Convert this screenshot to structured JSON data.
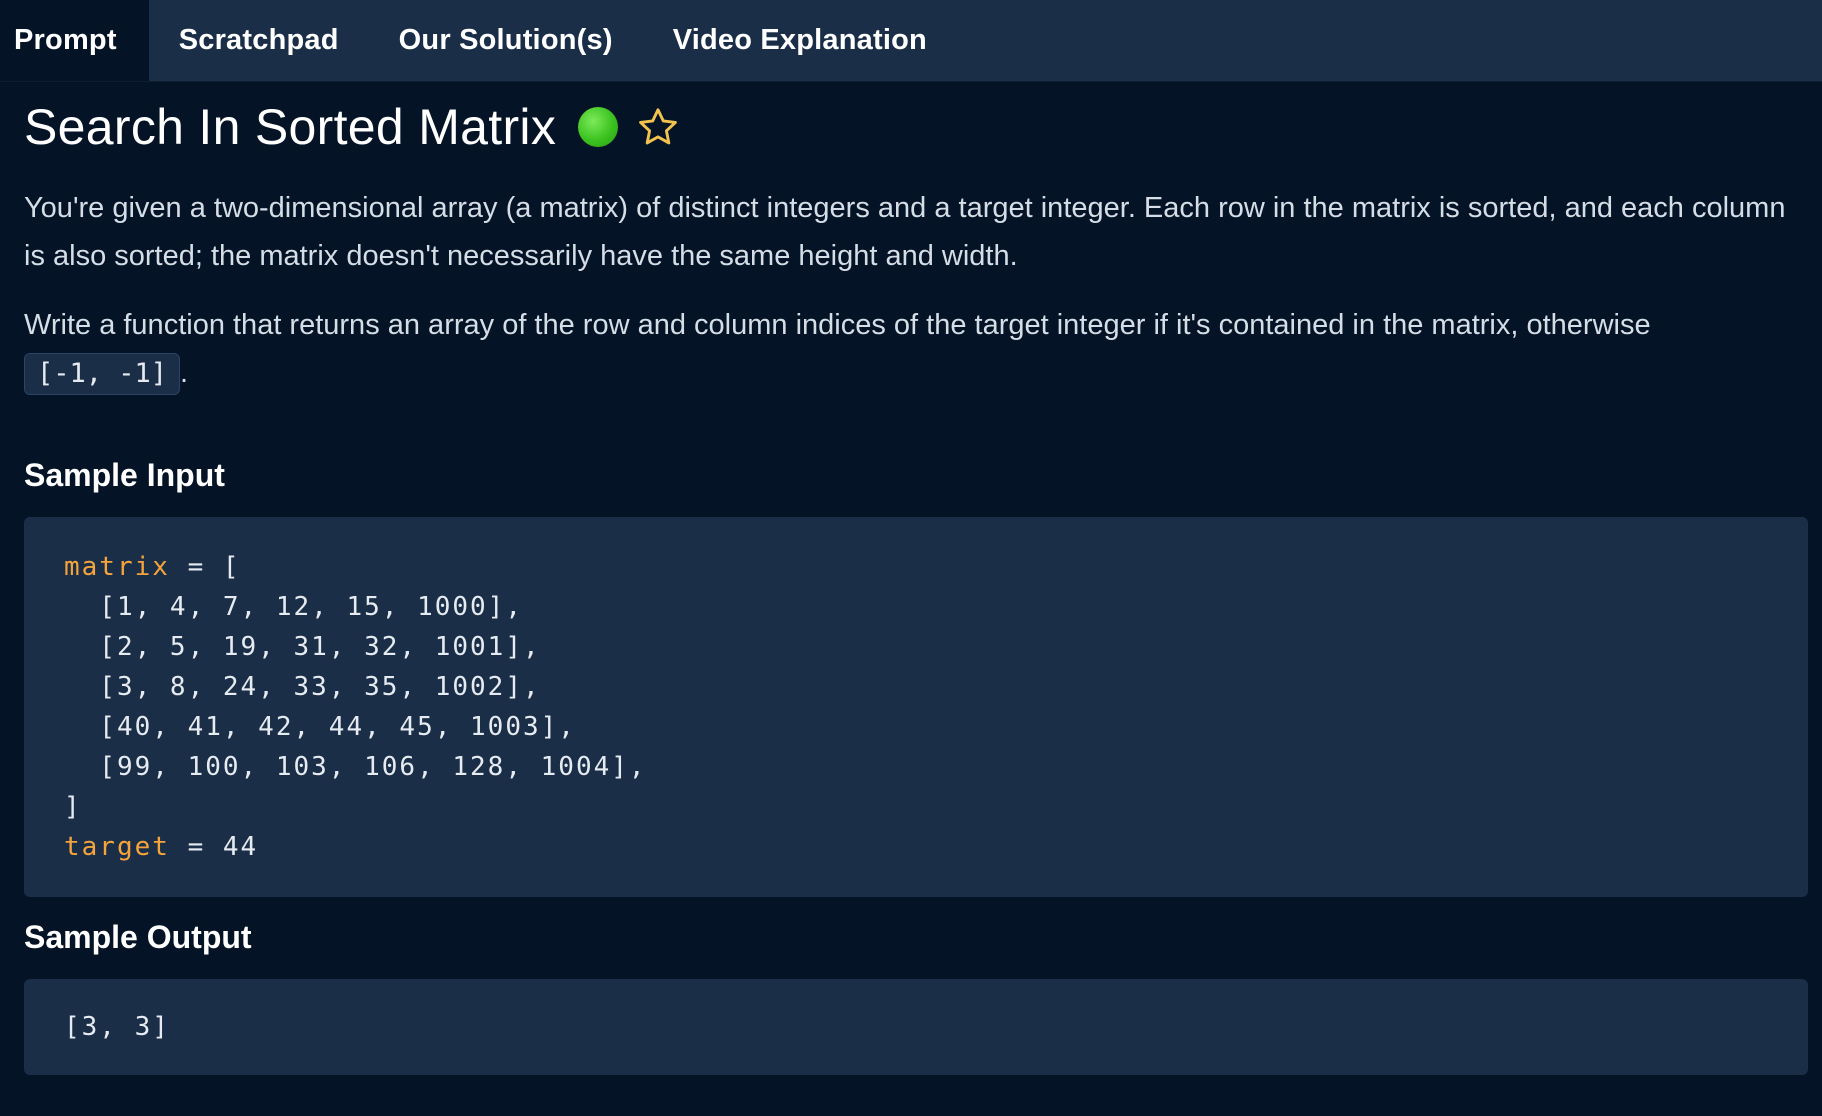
{
  "tabs": [
    {
      "label": "Prompt",
      "active": true
    },
    {
      "label": "Scratchpad",
      "active": false
    },
    {
      "label": "Our Solution(s)",
      "active": false
    },
    {
      "label": "Video Explanation",
      "active": false
    }
  ],
  "problem": {
    "title": "Search In Sorted Matrix",
    "difficulty_color": "#3bc21f",
    "favorite_icon": "star-outline-icon",
    "description_1": "You're given a two-dimensional array (a matrix) of distinct integers and a target integer. Each row in the matrix is sorted, and each column is also sorted; the matrix doesn't necessarily have the same height and width.",
    "description_2": "Write a function that returns an array of the row and column indices of the target integer if it's contained in the matrix, otherwise",
    "default_return": "[-1, -1]",
    "description_2_end": "."
  },
  "sample_input": {
    "heading": "Sample Input",
    "var_matrix": "matrix",
    "assign_open": " = [",
    "rows": [
      "  [1, 4, 7, 12, 15, 1000],",
      "  [2, 5, 19, 31, 32, 1001],",
      "  [3, 8, 24, 33, 35, 1002],",
      "  [40, 41, 42, 44, 45, 1003],",
      "  [99, 100, 103, 106, 128, 1004],"
    ],
    "close": "]",
    "var_target": "target",
    "target_assign": " = 44"
  },
  "sample_output": {
    "heading": "Sample Output",
    "value": "[3, 3]"
  },
  "colors": {
    "background": "#041325",
    "panel": "#1b2e48",
    "keyword": "#f5a43b"
  }
}
